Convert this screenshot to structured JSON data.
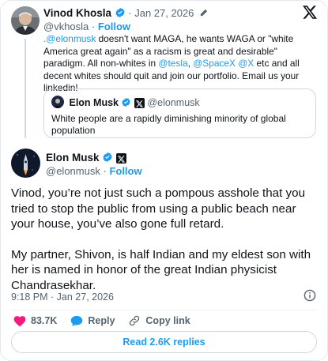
{
  "reply_to": {
    "author_name": "Vinod Khosla",
    "handle": "@vkhosla",
    "date": "Jan 27, 2026",
    "separator": "·",
    "follow_label": "Follow",
    "text": {
      "mention_elonmusk": ".@elonmusk",
      "part1": " doesn't want MAGA, he wants WAGA or \"white America great again\" as a racism is great and desirable\" paradigm. All non-whites in ",
      "mention_tesla": "@tesla",
      "comma": ", ",
      "mention_spacex": "@SpaceX",
      "space": " ",
      "mention_x": "@X",
      "part2": " etc and all decent whites should quit and join our portfolio. Email us your linkedin!"
    },
    "quote": {
      "author_name": "Elon Musk",
      "handle": "@elonmusk",
      "text": "White people are a rapidly diminishing minority of global population"
    }
  },
  "main_tweet": {
    "author_name": "Elon Musk",
    "handle": "@elonmusk",
    "separator": "·",
    "follow_label": "Follow",
    "paragraph1": "Vinod, you’re not just such a pompous asshole that you tried to stop the public from using a public beach near your house, you’ve also gone full retard.",
    "paragraph2": "My partner, Shivon, is half Indian and my eldest son with her is named in honor of the great Indian physicist Chandrasekhar.",
    "timestamp": "9:18 PM · Jan 27, 2026"
  },
  "actions": {
    "like_count": "83.7K",
    "reply_label": "Reply",
    "copy_link_label": "Copy link"
  },
  "read_replies_label": "Read 2.6K replies",
  "icons": {
    "verified": "verified-badge-icon",
    "brand_logo": "x-logo-icon",
    "edited": "pencil-icon",
    "info": "info-icon",
    "like": "heart-icon",
    "reply": "speech-bubble-icon",
    "copy_link": "link-icon"
  },
  "colors": {
    "accent": "#1d9bf0",
    "like": "#f91880",
    "text": "#0f1419",
    "muted": "#536471",
    "border": "#cfd9de"
  }
}
